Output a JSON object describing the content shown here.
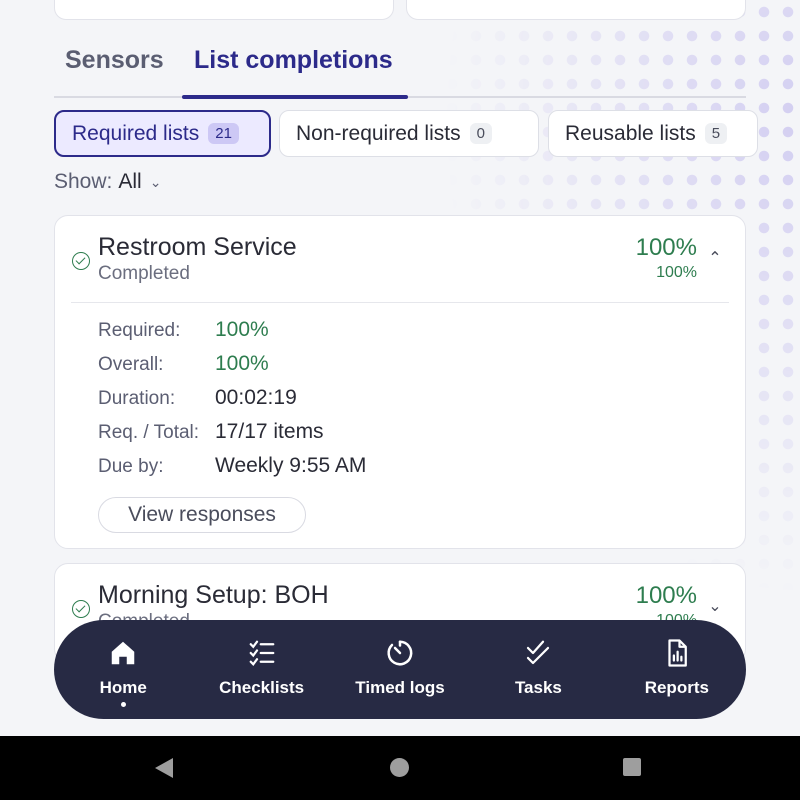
{
  "tabs": [
    {
      "label": "Sensors",
      "active": false
    },
    {
      "label": "List completions",
      "active": true
    }
  ],
  "filter_chips": [
    {
      "label": "Required lists",
      "count": "21",
      "active": true
    },
    {
      "label": "Non-required lists",
      "count": "0",
      "active": false
    },
    {
      "label": "Reusable lists",
      "count": "5",
      "active": false
    }
  ],
  "show_filter": {
    "label": "Show:",
    "value": "All"
  },
  "cards": [
    {
      "title": "Restroom Service",
      "status": "Completed",
      "percent_main": "100%",
      "percent_sub": "100%",
      "expanded": true,
      "details": [
        {
          "label": "Required:",
          "value": "100%"
        },
        {
          "label": "Overall:",
          "value": "100%"
        },
        {
          "label": "Duration:",
          "value": "00:02:19"
        },
        {
          "label": "Req. / Total:",
          "value": "17/17 items"
        },
        {
          "label": "Due by:",
          "value": "Weekly 9:55 AM"
        }
      ],
      "view_button": "View responses"
    },
    {
      "title": "Morning Setup: BOH",
      "status": "Completed",
      "percent_main": "100%",
      "percent_sub": "100%",
      "expanded": false
    }
  ],
  "bottom_nav": [
    {
      "label": "Home",
      "icon": "home-icon",
      "active": true
    },
    {
      "label": "Checklists",
      "icon": "checklist-icon",
      "active": false
    },
    {
      "label": "Timed logs",
      "icon": "timer-icon",
      "active": false
    },
    {
      "label": "Tasks",
      "icon": "double-check-icon",
      "active": false
    },
    {
      "label": "Reports",
      "icon": "report-icon",
      "active": false
    }
  ],
  "colors": {
    "accent": "#2c2a8a",
    "success": "#2e7d4f",
    "nav_background": "#272a44"
  }
}
